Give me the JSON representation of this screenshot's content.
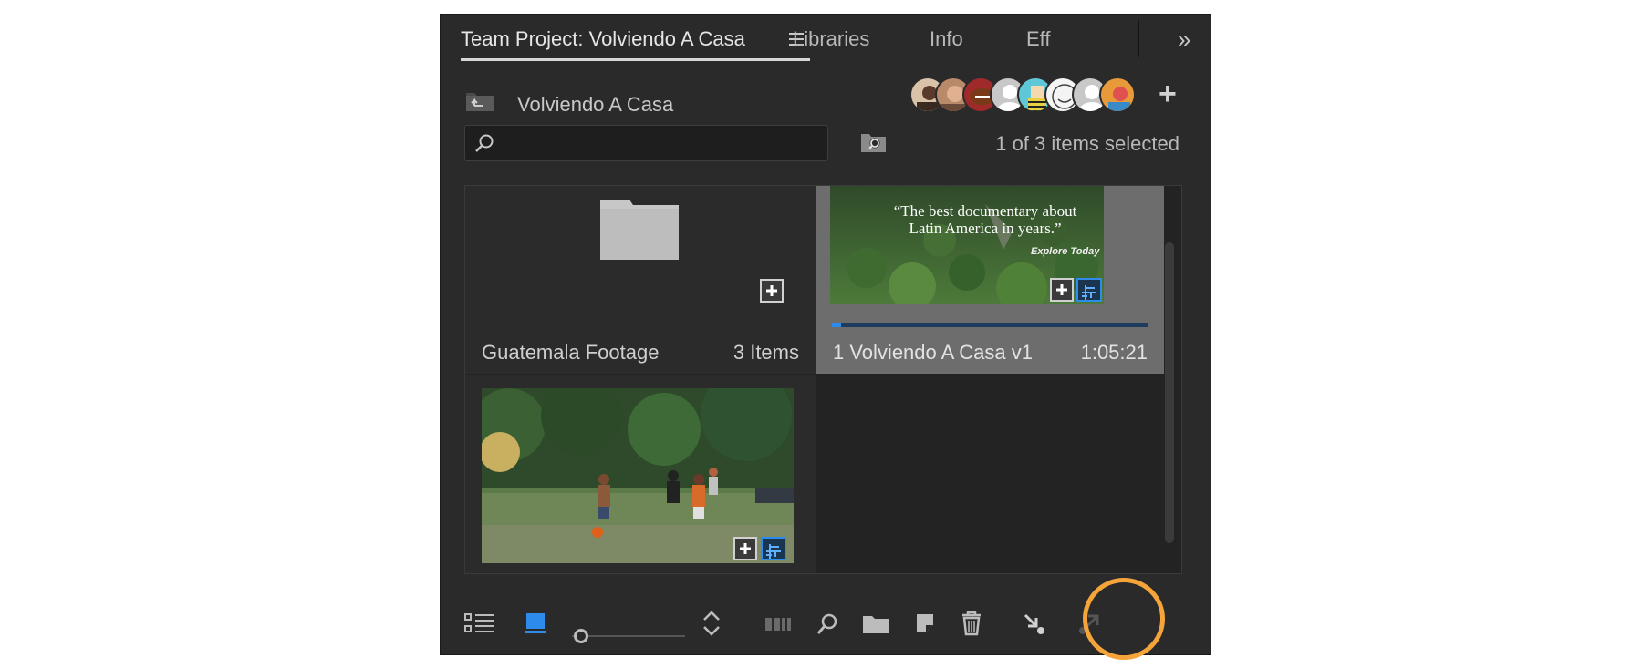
{
  "tabs": [
    {
      "label": "Team Project: Volviendo A Casa",
      "active": true
    },
    {
      "label": "Libraries"
    },
    {
      "label": "Info"
    },
    {
      "label": "Eff"
    }
  ],
  "header": {
    "project_name": "Volviendo A Casa",
    "collaborator_count": 8
  },
  "search": {
    "value": "",
    "placeholder": ""
  },
  "selection_status": "1 of 3 items selected",
  "items": [
    {
      "type": "bin",
      "name": "Guatemala Footage",
      "meta": "3 Items"
    },
    {
      "type": "sequence",
      "name": "1 Volviendo A Casa v1",
      "meta": "1:05:21",
      "thumbnail_text": "“The best documentary about Latin America in years.”",
      "thumbnail_caption": "Explore Today",
      "selected": true
    },
    {
      "type": "clip",
      "name": "",
      "meta": ""
    }
  ],
  "toolbar": {
    "icons": [
      "list-view-icon",
      "icon-view-icon",
      "zoom-slider",
      "sort-icons-icon",
      "automate-to-sequence-icon",
      "find-icon",
      "new-bin-icon",
      "new-item-icon",
      "clear-icon",
      "share-changes-icon",
      "get-changes-icon"
    ],
    "highlighted": "share-changes-icon"
  },
  "colors": {
    "panel_bg": "#2a2a2a",
    "accent_blue": "#2d8ceb",
    "highlight_ring": "#f5a43a"
  }
}
